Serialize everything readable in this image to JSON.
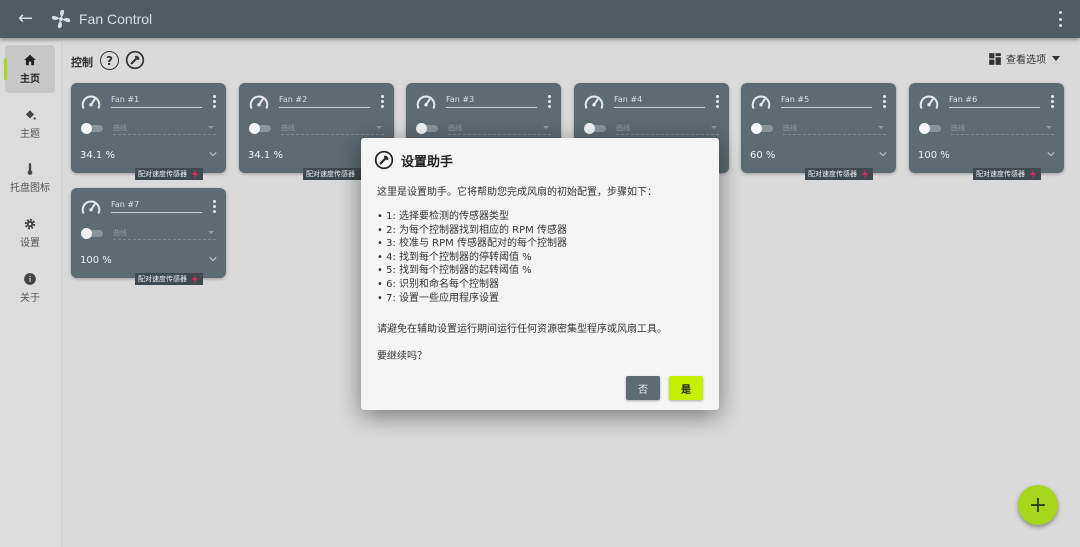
{
  "app": {
    "title": "Fan Control"
  },
  "sidebar": {
    "items": [
      {
        "label": "主页",
        "icon": "home-icon"
      },
      {
        "label": "主题",
        "icon": "paint-bucket-icon"
      },
      {
        "label": "托盘图标",
        "icon": "thermometer-icon"
      },
      {
        "label": "设置",
        "icon": "gear-icon"
      },
      {
        "label": "关于",
        "icon": "info-icon"
      }
    ]
  },
  "header": {
    "section_title": "控制",
    "help_label": "?",
    "view_options_label": "查看选项"
  },
  "cards": [
    {
      "name": "Fan #1",
      "curve": "曲线",
      "percent": "34.1 %",
      "pair_label": "配对速度传感器"
    },
    {
      "name": "Fan #2",
      "curve": "曲线",
      "percent": "34.1 %",
      "pair_label": "配对速度传感器"
    },
    {
      "name": "Fan #3",
      "curve": "曲线",
      "percent": "",
      "pair_label": ""
    },
    {
      "name": "Fan #4",
      "curve": "曲线",
      "percent": "",
      "pair_label": ""
    },
    {
      "name": "Fan #5",
      "curve": "曲线",
      "percent": "60 %",
      "pair_label": "配对速度传感器"
    },
    {
      "name": "Fan #6",
      "curve": "曲线",
      "percent": "100 %",
      "pair_label": "配对速度传感器"
    },
    {
      "name": "Fan #7",
      "curve": "曲线",
      "percent": "100 %",
      "pair_label": "配对速度传感器"
    }
  ],
  "fab": {
    "label": "+"
  },
  "dialog": {
    "title": "设置助手",
    "intro": "这里是设置助手。它将帮助您完成风扇的初始配置，步骤如下：",
    "steps": [
      "1: 选择要检测的传感器类型",
      "2: 为每个控制器找到相应的 RPM 传感器",
      "3: 校准与 RPM 传感器配对的每个控制器",
      "4: 找到每个控制器的停转阈值 %",
      "5: 找到每个控制器的起转阈值 %",
      "6: 识别和命名每个控制器",
      "7: 设置一些应用程序设置"
    ],
    "warning": "请避免在辅助设置运行期间运行任何资源密集型程序或风扇工具。",
    "question": "要继续吗？",
    "no_label": "否",
    "yes_label": "是"
  },
  "colors": {
    "titlebar": "#4f5d63",
    "card": "#5d6b72",
    "accent": "#a6d61a",
    "yes_button": "#c4f000",
    "sensor_bolt": "#e0245e"
  }
}
